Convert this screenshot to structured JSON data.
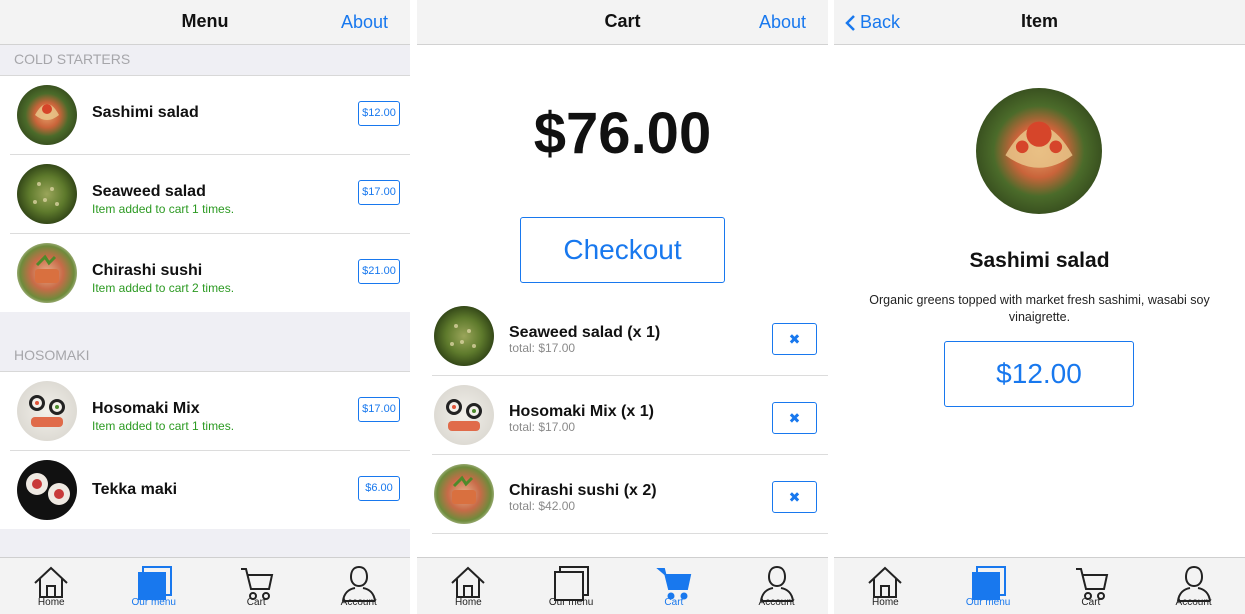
{
  "menu_screen": {
    "title": "Menu",
    "about": "About",
    "sections": [
      {
        "header": "COLD STARTERS",
        "items": [
          {
            "name": "Sashimi salad",
            "price": "$12.00",
            "note": ""
          },
          {
            "name": "Seaweed salad",
            "price": "$17.00",
            "note": "Item added to cart 1 times."
          },
          {
            "name": "Chirashi sushi",
            "price": "$21.00",
            "note": "Item added to cart 2 times."
          }
        ]
      },
      {
        "header": "HOSOMAKI",
        "items": [
          {
            "name": "Hosomaki Mix",
            "price": "$17.00",
            "note": "Item added to cart 1 times."
          },
          {
            "name": "Tekka maki",
            "price": "$6.00",
            "note": ""
          }
        ]
      }
    ],
    "active_tab": "Our menu"
  },
  "cart_screen": {
    "title": "Cart",
    "about": "About",
    "total": "$76.00",
    "checkout": "Checkout",
    "remove_glyph": "✖",
    "items": [
      {
        "name": "Seaweed salad (x 1)",
        "sub": "total: $17.00"
      },
      {
        "name": "Hosomaki Mix (x 1)",
        "sub": "total: $17.00"
      },
      {
        "name": "Chirashi sushi (x 2)",
        "sub": "total: $42.00"
      }
    ],
    "active_tab": "Cart"
  },
  "item_screen": {
    "back": "Back",
    "title": "Item",
    "name": "Sashimi salad",
    "description": "Organic greens topped with market fresh sashimi, wasabi soy vinaigrette.",
    "price": "$12.00",
    "active_tab": "Our menu"
  },
  "tabs": [
    {
      "label": "Home",
      "icon": "home-icon"
    },
    {
      "label": "Our menu",
      "icon": "menu-icon"
    },
    {
      "label": "Cart",
      "icon": "cart-icon"
    },
    {
      "label": "Account",
      "icon": "account-icon"
    }
  ],
  "colors": {
    "accent": "#1878ee",
    "added_note": "#2c9a22",
    "section_bg": "#efeff4"
  }
}
